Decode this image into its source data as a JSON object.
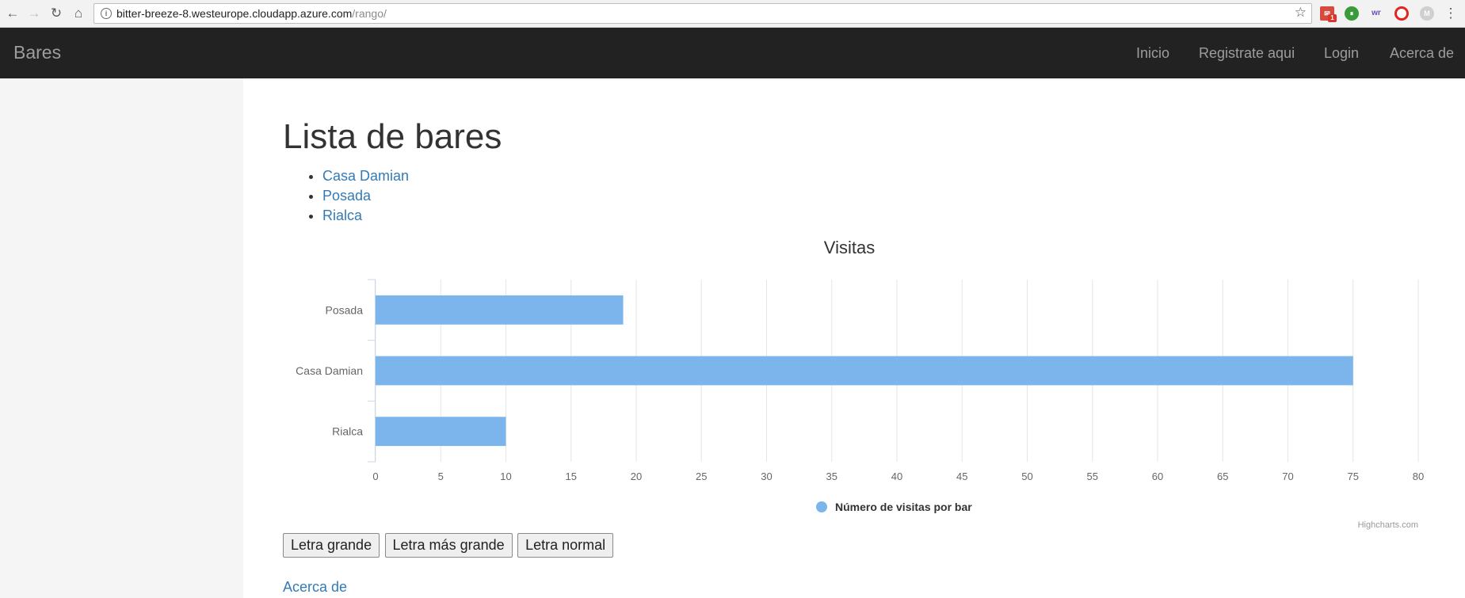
{
  "browser": {
    "url_host": "bitter-breeze-8.westeurope.cloudapp.azure.com",
    "url_path": "/rango/",
    "gmail_badge": "1"
  },
  "navbar": {
    "brand": "Bares",
    "links": [
      "Inicio",
      "Registrate aqui",
      "Login",
      "Acerca de"
    ]
  },
  "page": {
    "title": "Lista de bares",
    "bars": [
      "Casa Damian",
      "Posada",
      "Rialca"
    ]
  },
  "chart_data": {
    "type": "bar",
    "orientation": "horizontal",
    "title": "Visitas",
    "categories": [
      "Posada",
      "Casa Damian",
      "Rialca"
    ],
    "series": [
      {
        "name": "Número de visitas por bar",
        "values": [
          19,
          75,
          10
        ],
        "color": "#7cb5ec"
      }
    ],
    "xlim": [
      0,
      80
    ],
    "ticks": [
      0,
      5,
      10,
      15,
      20,
      25,
      30,
      35,
      40,
      45,
      50,
      55,
      60,
      65,
      70,
      75,
      80
    ],
    "grid": true,
    "legend": "bottom-center",
    "credits": "Highcharts.com"
  },
  "buttons": [
    "Letra grande",
    "Letra más grande",
    "Letra normal"
  ],
  "footer": {
    "about_link": "Acerca de"
  },
  "colors": {
    "navbar_bg": "#222222",
    "link": "#337ab7",
    "bar": "#7cb5ec",
    "sidebar_bg": "#f5f5f5"
  }
}
